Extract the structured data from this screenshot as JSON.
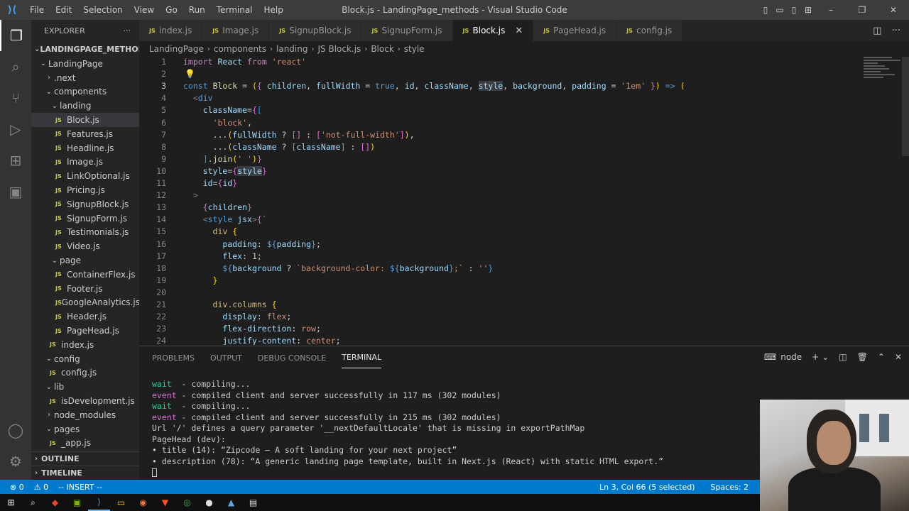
{
  "window": {
    "title": "Block.js - LandingPage_methods - Visual Studio Code",
    "menu": [
      "File",
      "Edit",
      "Selection",
      "View",
      "Go",
      "Run",
      "Terminal",
      "Help"
    ]
  },
  "sidebar": {
    "header": "EXPLORER",
    "root": "LANDINGPAGE_METHODS",
    "tree": [
      {
        "label": "LandingPage",
        "type": "folder-open",
        "depth": 0
      },
      {
        "label": ".next",
        "type": "folder-closed",
        "depth": 1
      },
      {
        "label": "components",
        "type": "folder-open",
        "depth": 1
      },
      {
        "label": "landing",
        "type": "folder-open",
        "depth": 2
      },
      {
        "label": "Block.js",
        "type": "file",
        "depth": 3,
        "selected": true
      },
      {
        "label": "Features.js",
        "type": "file",
        "depth": 3
      },
      {
        "label": "Headline.js",
        "type": "file",
        "depth": 3
      },
      {
        "label": "Image.js",
        "type": "file",
        "depth": 3
      },
      {
        "label": "LinkOptional.js",
        "type": "file",
        "depth": 3
      },
      {
        "label": "Pricing.js",
        "type": "file",
        "depth": 3
      },
      {
        "label": "SignupBlock.js",
        "type": "file",
        "depth": 3
      },
      {
        "label": "SignupForm.js",
        "type": "file",
        "depth": 3
      },
      {
        "label": "Testimonials.js",
        "type": "file",
        "depth": 3
      },
      {
        "label": "Video.js",
        "type": "file",
        "depth": 3
      },
      {
        "label": "page",
        "type": "folder-open",
        "depth": 2
      },
      {
        "label": "ContainerFlex.js",
        "type": "file",
        "depth": 3
      },
      {
        "label": "Footer.js",
        "type": "file",
        "depth": 3
      },
      {
        "label": "GoogleAnalytics.js",
        "type": "file",
        "depth": 3
      },
      {
        "label": "Header.js",
        "type": "file",
        "depth": 3
      },
      {
        "label": "PageHead.js",
        "type": "file",
        "depth": 3
      },
      {
        "label": "index.js",
        "type": "file",
        "depth": 2
      },
      {
        "label": "config",
        "type": "folder-open",
        "depth": 1
      },
      {
        "label": "config.js",
        "type": "file",
        "depth": 2
      },
      {
        "label": "lib",
        "type": "folder-open",
        "depth": 1
      },
      {
        "label": "isDevelopment.js",
        "type": "file",
        "depth": 2
      },
      {
        "label": "node_modules",
        "type": "folder-closed",
        "depth": 1
      },
      {
        "label": "pages",
        "type": "folder-open",
        "depth": 1
      },
      {
        "label": "_app.js",
        "type": "file",
        "depth": 2
      }
    ],
    "outline": "OUTLINE",
    "timeline": "TIMELINE"
  },
  "tabs": [
    {
      "label": "index.js",
      "active": false
    },
    {
      "label": "Image.js",
      "active": false
    },
    {
      "label": "SignupBlock.js",
      "active": false
    },
    {
      "label": "SignupForm.js",
      "active": false
    },
    {
      "label": "Block.js",
      "active": true
    },
    {
      "label": "PageHead.js",
      "active": false
    },
    {
      "label": "config.js",
      "active": false
    }
  ],
  "breadcrumb": [
    "LandingPage",
    "components",
    "landing",
    "JS Block.js",
    "Block",
    "style"
  ],
  "editor": {
    "lines": [
      {
        "n": "1",
        "html": "<span class=\"kw\">import</span> <span class=\"var\">React</span> <span class=\"kw\">from</span> <span class=\"str\">'react'</span>"
      },
      {
        "n": "2",
        "html": ""
      },
      {
        "n": "3",
        "html": "<span class=\"kb\">const</span> <span class=\"fn\">Block</span> = <span class=\"br\">(</span><span class=\"br2\">{</span> <span class=\"var\">children</span>, <span class=\"var\">fullWidth</span> = <span class=\"kb\">true</span>, <span class=\"var\">id</span>, <span class=\"var\">className</span>, <span class=\"var hl\">style</span>, <span class=\"var\">background</span>, <span class=\"var\">padding</span> = <span class=\"str\">'1em'</span> <span class=\"br2\">}</span><span class=\"br\">)</span> <span class=\"kb\">=&gt;</span> <span class=\"br\">(</span>"
      },
      {
        "n": "4",
        "html": "  <span class=\"pun\">&lt;</span><span class=\"tag\">div</span>"
      },
      {
        "n": "5",
        "html": "    <span class=\"attr\">className</span>=<span class=\"br2\">{</span><span class=\"br3\">[</span>"
      },
      {
        "n": "6",
        "html": "      <span class=\"str\">'block'</span>,"
      },
      {
        "n": "7",
        "html": "      ...<span class=\"br\">(</span><span class=\"var\">fullWidth</span> ? <span class=\"br2\">[]</span> : <span class=\"br2\">[</span><span class=\"str\">'not-full-width'</span><span class=\"br2\">]</span><span class=\"br\">)</span>,"
      },
      {
        "n": "8",
        "html": "      ...<span class=\"br\">(</span><span class=\"var\">className</span> ? <span class=\"br2\">[</span><span class=\"var\">className</span><span class=\"br2\">]</span> : <span class=\"br2\">[]</span><span class=\"br\">)</span>"
      },
      {
        "n": "9",
        "html": "    <span class=\"br3\">]</span>.<span class=\"fn\">join</span><span class=\"br\">(</span><span class=\"str\">' '</span><span class=\"br\">)</span><span class=\"br2\">}</span>"
      },
      {
        "n": "10",
        "html": "    <span class=\"attr\">style</span>=<span class=\"br2\">{</span><span class=\"var hl\">style</span><span class=\"br2\">}</span>"
      },
      {
        "n": "11",
        "html": "    <span class=\"attr\">id</span>=<span class=\"br2\">{</span><span class=\"var\">id</span><span class=\"br2\">}</span>"
      },
      {
        "n": "12",
        "html": "  <span class=\"pun\">&gt;</span>"
      },
      {
        "n": "13",
        "html": "    <span class=\"br2\">{</span><span class=\"var\">children</span><span class=\"br2\">}</span>"
      },
      {
        "n": "14",
        "html": "    <span class=\"pun\">&lt;</span><span class=\"tag\">style</span> <span class=\"attr\">jsx</span><span class=\"pun\">&gt;</span><span class=\"br2\">{</span><span class=\"str\">`</span>"
      },
      {
        "n": "15",
        "html": "      <span class=\"css\">div</span> <span class=\"br\">{</span>"
      },
      {
        "n": "16",
        "html": "        <span class=\"prop\">padding</span>: <span class=\"kb\">${</span><span class=\"var\">padding</span><span class=\"kb\">}</span>;"
      },
      {
        "n": "17",
        "html": "        <span class=\"prop\">flex</span>: <span class=\"num\">1</span>;"
      },
      {
        "n": "18",
        "html": "        <span class=\"kb\">${</span><span class=\"var\">background</span> ? <span class=\"str\">`background-color: </span><span class=\"kb\">${</span><span class=\"var\">background</span><span class=\"kb\">}</span><span class=\"str\">;`</span> : <span class=\"str\">''</span><span class=\"kb\">}</span>"
      },
      {
        "n": "19",
        "html": "      <span class=\"br\">}</span>"
      },
      {
        "n": "20",
        "html": ""
      },
      {
        "n": "21",
        "html": "      <span class=\"css\">div.columns</span> <span class=\"br\">{</span>"
      },
      {
        "n": "22",
        "html": "        <span class=\"prop\">display</span>: <span class=\"str\">flex</span>;"
      },
      {
        "n": "23",
        "html": "        <span class=\"prop\">flex-direction</span>: <span class=\"str\">row</span>;"
      },
      {
        "n": "24",
        "html": "        <span class=\"prop\">justify-content</span>: <span class=\"str\">center</span>;"
      }
    ]
  },
  "panel": {
    "tabs": [
      {
        "label": "PROBLEMS",
        "active": false
      },
      {
        "label": "OUTPUT",
        "active": false
      },
      {
        "label": "DEBUG CONSOLE",
        "active": false
      },
      {
        "label": "TERMINAL",
        "active": true
      }
    ],
    "shell": "node",
    "terminal": [
      {
        "type": "wait",
        "prefix": "wait",
        "text": "  - compiling..."
      },
      {
        "type": "event",
        "prefix": "event",
        "text": " - compiled client and server successfully in 117 ms (302 modules)"
      },
      {
        "type": "wait",
        "prefix": "wait",
        "text": "  - compiling..."
      },
      {
        "type": "event",
        "prefix": "event",
        "text": " - compiled client and server successfully in 215 ms (302 modules)"
      },
      {
        "type": "plain",
        "prefix": "",
        "text": "Url '/' defines a query parameter '__nextDefaultLocale' that is missing in exportPathMap"
      },
      {
        "type": "plain",
        "prefix": "",
        "text": "PageHead (dev):"
      },
      {
        "type": "plain",
        "prefix": "",
        "text": "• title (14): “Zipcode – A soft landing for your next project”"
      },
      {
        "type": "plain",
        "prefix": "",
        "text": "• description (78): “A generic landing page template, built in Next.js (React) with static HTML export.”"
      }
    ]
  },
  "status": {
    "errors": "⊗ 0",
    "warnings": "⚠ 0",
    "mode": "-- INSERT --",
    "position": "Ln 3, Col 66 (5 selected)",
    "spaces": "Spaces: 2"
  },
  "colors": {
    "accent": "#007acc",
    "editor_bg": "#1e1e1e",
    "sidebar_bg": "#252526"
  }
}
